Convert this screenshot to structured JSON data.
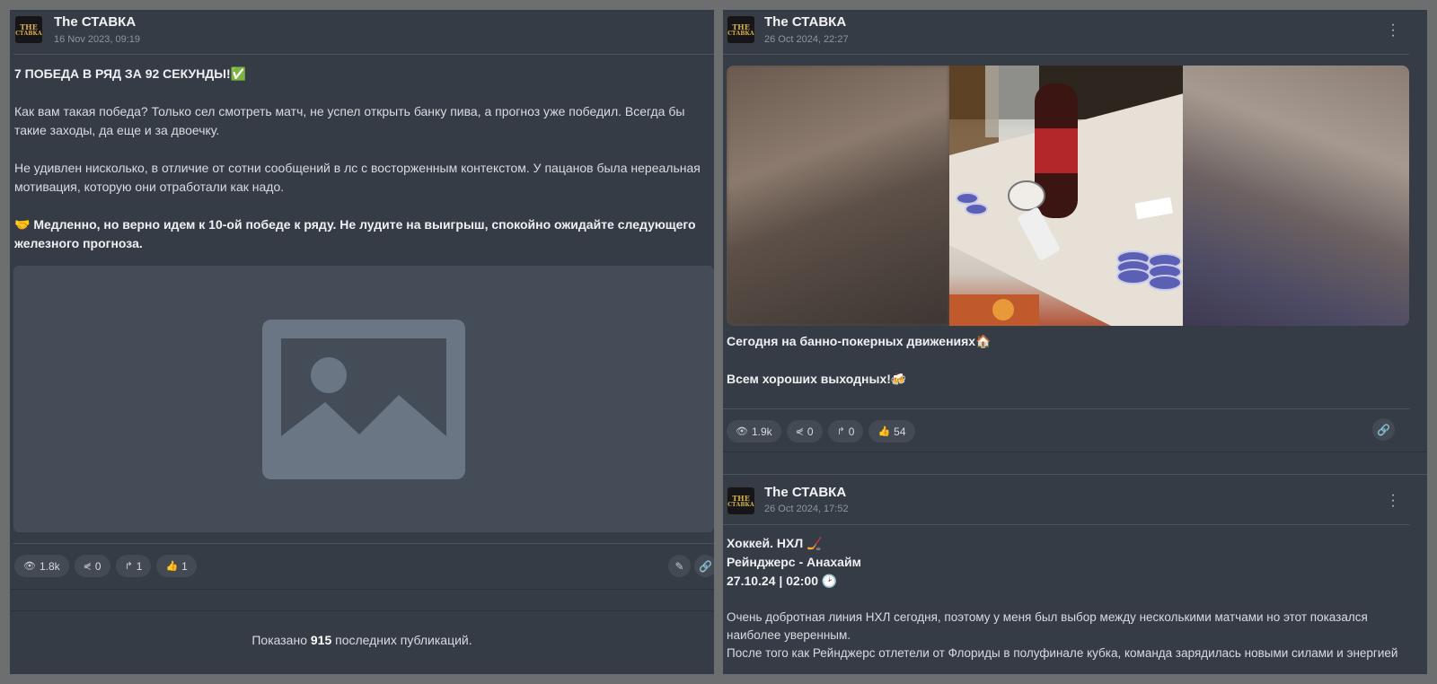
{
  "left_post": {
    "channel": "The СТАВКА",
    "avatar_top": "THE",
    "avatar_bottom": "СТАВКА",
    "date": "16 Nov 2023, 09:19",
    "title": "7 ПОБЕДА В РЯД ЗА 92 СЕКУНДЫ!✅",
    "paragraph1_line1": "Как вам такая победа? Только сел смотреть матч, не успел открыть банку пива, а прогноз уже победил. Всегда бы",
    "paragraph1_line2": "такие заходы, да еще и за двоечку.",
    "paragraph2_line1": "Не удивлен нисколько, в отличие от сотни сообщений в лс с восторженным контекстом. У пацанов была нереальная",
    "paragraph2_line2": "мотивация, которую они отработали как надо.",
    "paragraph3_line1": "🤝 Медленно, но верно идем к 10-ой победе к ряду. Не лудите на выигрыш, спокойно ожидайте следующего",
    "paragraph3_line2": "железного прогноза.",
    "stats": {
      "views": "1.8k",
      "shares": "0",
      "forwards": "1",
      "likes": "1"
    },
    "footer_prefix": "Показано",
    "footer_count": "915",
    "footer_suffix": "последних публикаций."
  },
  "right_post_1": {
    "channel": "The СТАВКА",
    "avatar_top": "THE",
    "avatar_bottom": "СТАВКА",
    "date": "26 Oct 2024, 22:27",
    "line1": "Сегодня на банно-покерных движениях🏠",
    "line2": "Всем хороших выходных!🍻",
    "stats": {
      "views": "1.9k",
      "shares": "0",
      "forwards": "0",
      "likes": "54"
    }
  },
  "right_post_2": {
    "channel": "The СТАВКА",
    "avatar_top": "THE",
    "avatar_bottom": "СТАВКА",
    "date": "26 Oct 2024, 17:52",
    "sport_line": "Хоккей. НХЛ 🏒",
    "match_line": "Рейнджерс - Анахайм",
    "time_line": "27.10.24 | 02:00 🕑",
    "body_line1": "Очень добротная линия НХЛ сегодня, поэтому у меня был выбор между несколькими матчами но этот показался",
    "body_line2": "наиболее уверенным.",
    "body_line3": "После того как Рейнджерс отлетели от Флориды в полуфинале кубка, команда зарядилась новыми силами и энергией"
  },
  "icons": {
    "views": "eye-icon",
    "shares": "share-icon",
    "forwards": "forward-icon",
    "likes": "thumbs-up-icon",
    "edit": "pencil-icon",
    "link": "link-icon",
    "menu": "kebab-menu-icon",
    "placeholder": "image-placeholder-icon"
  }
}
